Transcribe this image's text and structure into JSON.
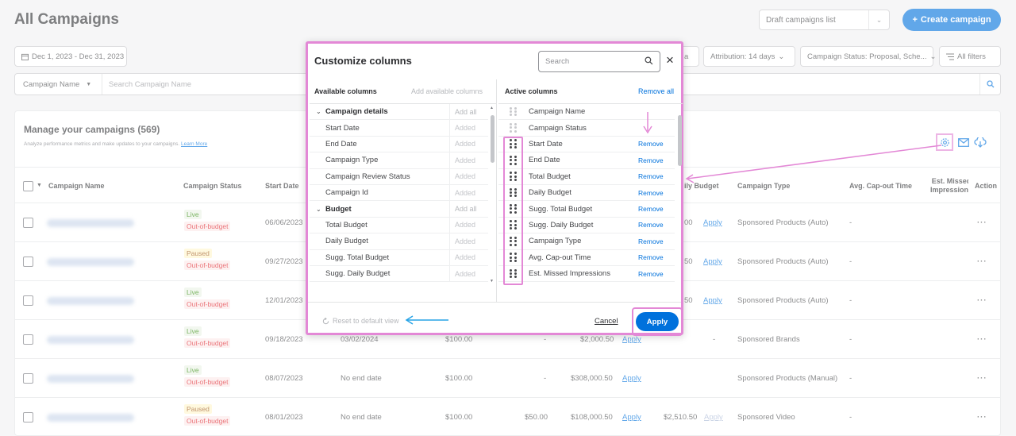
{
  "header": {
    "title": "All Campaigns",
    "view_select": "Draft campaigns list",
    "create_button": "Create campaign",
    "create_plus": "+"
  },
  "filters": {
    "date_range": "Dec 1, 2023 - Dec 31, 2023",
    "attribution": "Attribution: 14 days",
    "campaign_status": "Campaign Status: Proposal, Sche...",
    "all_filters": "All filters",
    "hidden_chip": "a"
  },
  "search": {
    "field_select": "Campaign Name",
    "placeholder": "Search Campaign Name"
  },
  "card": {
    "title": "Manage your campaigns (569)",
    "subtitle": "Analyze performance metrics and make updates to your campaigns.",
    "learn_more": "Learn More"
  },
  "table": {
    "headers": {
      "campaign_name": "Campaign Name",
      "campaign_status": "Campaign Status",
      "start_date": "Start Date",
      "daily_budget": "ily Budget",
      "campaign_type": "Campaign Type",
      "avg_capout": "Avg. Cap-out Time",
      "missed": "Est. Missed Impressions",
      "action": "Action"
    },
    "rows": [
      {
        "status": "Live",
        "oob": "Out-of-budget",
        "start": "06/06/2023",
        "end": "",
        "tb": "",
        "sdb": "",
        "total": "",
        "daily": "00",
        "apply": "Apply",
        "type": "Sponsored Products (Auto)",
        "capout": "-"
      },
      {
        "status": "Paused",
        "oob": "Out-of-budget",
        "start": "09/27/2023",
        "end": "",
        "tb": "",
        "sdb": "",
        "total": "",
        "daily": "50",
        "apply": "Apply",
        "type": "Sponsored Products (Auto)",
        "capout": "-"
      },
      {
        "status": "Live",
        "oob": "Out-of-budget",
        "start": "12/01/2023",
        "end": "",
        "tb": "",
        "sdb": "",
        "total": "",
        "daily": "50",
        "apply": "Apply",
        "type": "Sponsored Products (Auto)",
        "capout": "-"
      },
      {
        "status": "Live",
        "oob": "Out-of-budget",
        "start": "09/18/2023",
        "end": "03/02/2024",
        "tb": "$100.00",
        "sdb": "-",
        "total": "$2,000.50",
        "daily": "-",
        "apply": "Apply",
        "type": "Sponsored Brands",
        "capout": "-"
      },
      {
        "status": "Live",
        "oob": "Out-of-budget",
        "start": "08/07/2023",
        "end": "No end date",
        "tb": "$100.00",
        "sdb": "-",
        "total": "$308,000.50",
        "daily": "",
        "apply": "Apply",
        "type": "Sponsored Products (Manual)",
        "capout": "-"
      },
      {
        "status": "Paused",
        "oob": "Out-of-budget",
        "start": "08/01/2023",
        "end": "No end date",
        "tb": "$100.00",
        "sdb": "$50.00",
        "total": "$108,000.50",
        "daily": "$2,510.50",
        "apply": "Apply",
        "apply2": "Apply",
        "type": "Sponsored Video",
        "capout": "-"
      }
    ],
    "action_dots": "···"
  },
  "modal": {
    "title": "Customize columns",
    "search_placeholder": "Search",
    "close": "×",
    "available_title": "Available columns",
    "add_available": "Add available columns",
    "active_title": "Active columns",
    "remove_all": "Remove all",
    "available": [
      {
        "name": "Campaign details",
        "group": true,
        "status": "Add all"
      },
      {
        "name": "Start Date",
        "group": false,
        "status": "Added"
      },
      {
        "name": "End Date",
        "group": false,
        "status": "Added"
      },
      {
        "name": "Campaign Type",
        "group": false,
        "status": "Added"
      },
      {
        "name": "Campaign Review Status",
        "group": false,
        "status": "Added"
      },
      {
        "name": "Campaign Id",
        "group": false,
        "status": "Added"
      },
      {
        "name": "Budget",
        "group": true,
        "status": "Add all"
      },
      {
        "name": "Total Budget",
        "group": false,
        "status": "Added"
      },
      {
        "name": "Daily Budget",
        "group": false,
        "status": "Added"
      },
      {
        "name": "Sugg. Total Budget",
        "group": false,
        "status": "Added"
      },
      {
        "name": "Sugg. Daily Budget",
        "group": false,
        "status": "Added"
      }
    ],
    "active": [
      {
        "name": "Campaign Name",
        "locked": true,
        "remove": ""
      },
      {
        "name": "Campaign Status",
        "locked": true,
        "remove": ""
      },
      {
        "name": "Start Date",
        "locked": false,
        "remove": "Remove"
      },
      {
        "name": "End Date",
        "locked": false,
        "remove": "Remove"
      },
      {
        "name": "Total Budget",
        "locked": false,
        "remove": "Remove"
      },
      {
        "name": "Daily Budget",
        "locked": false,
        "remove": "Remove"
      },
      {
        "name": "Sugg. Total Budget",
        "locked": false,
        "remove": "Remove"
      },
      {
        "name": "Sugg. Daily Budget",
        "locked": false,
        "remove": "Remove"
      },
      {
        "name": "Campaign Type",
        "locked": false,
        "remove": "Remove"
      },
      {
        "name": "Avg. Cap-out Time",
        "locked": false,
        "remove": "Remove"
      },
      {
        "name": "Est. Missed Impressions",
        "locked": false,
        "remove": "Remove"
      }
    ],
    "reset": "Reset to default view",
    "cancel": "Cancel",
    "apply": "Apply"
  },
  "colors": {
    "accent": "#0071dc",
    "annotation": "#e388d6",
    "annotation_arrow_blue": "#27a3e6"
  }
}
